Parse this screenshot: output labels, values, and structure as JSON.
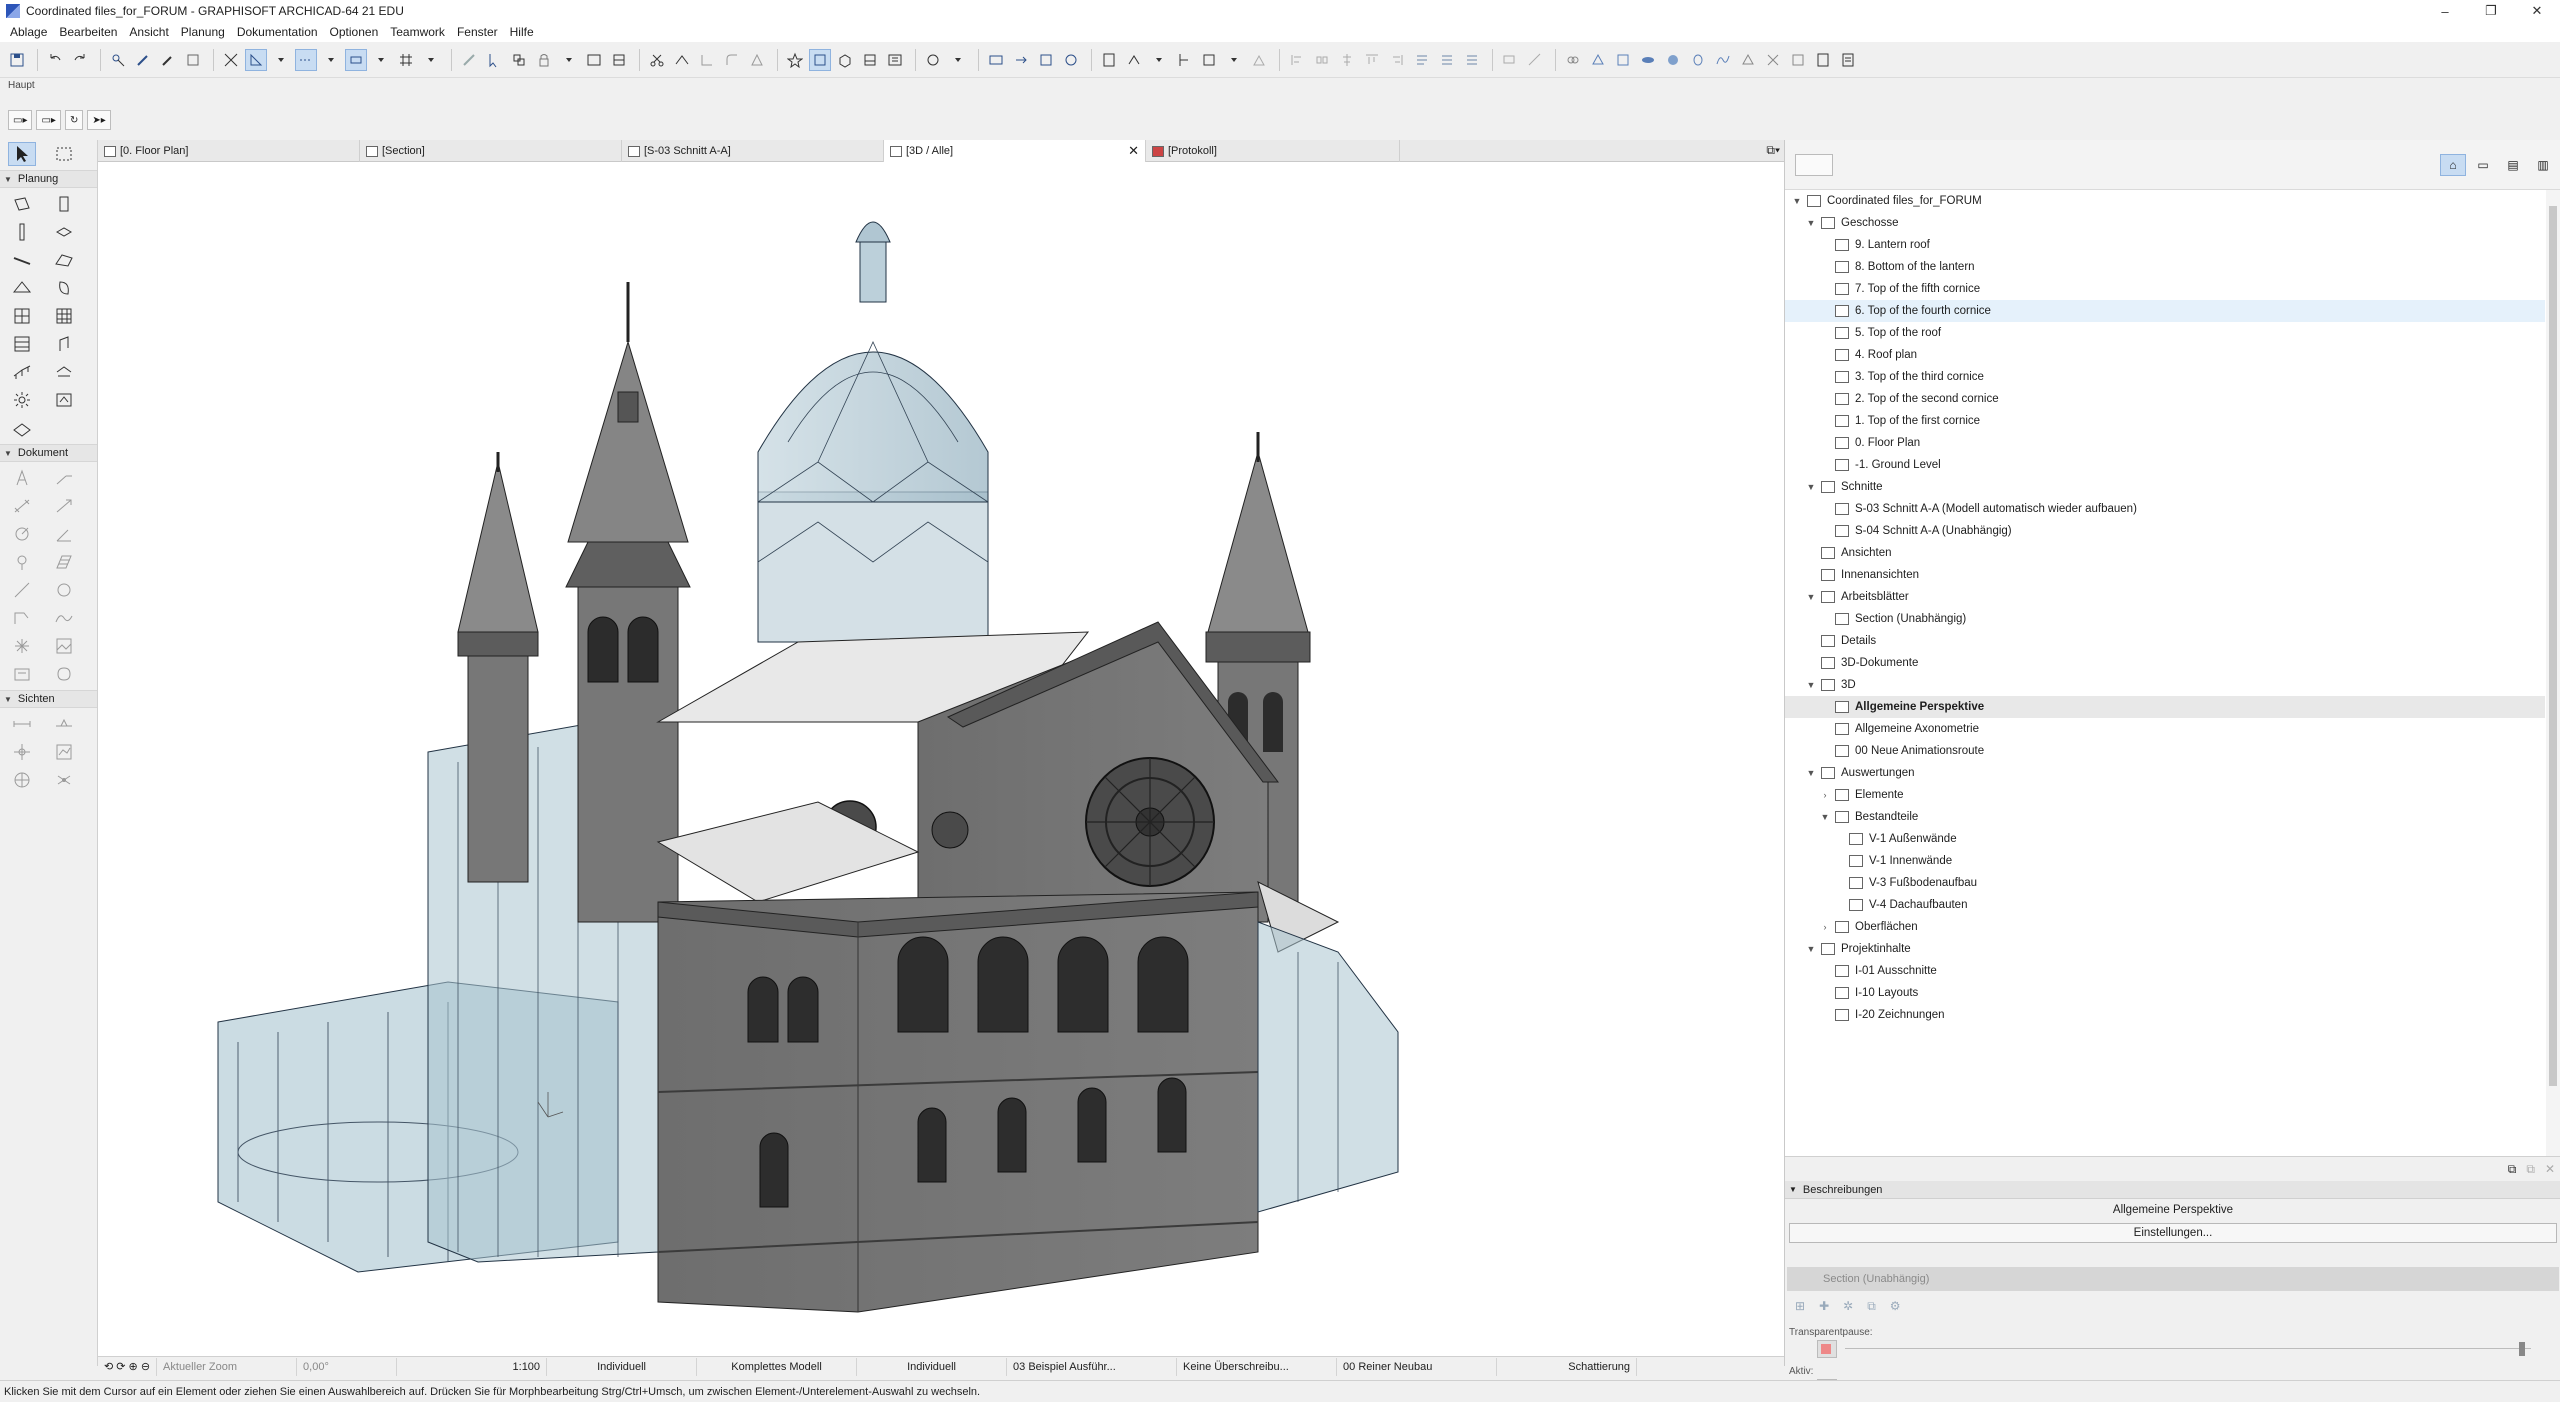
{
  "window": {
    "title": "Coordinated files_for_FORUM - GRAPHISOFT ARCHICAD-64 21 EDU",
    "minimize": "–",
    "restore": "❐",
    "close": "✕"
  },
  "menu": [
    "Ablage",
    "Bearbeiten",
    "Ansicht",
    "Planung",
    "Dokumentation",
    "Optionen",
    "Teamwork",
    "Fenster",
    "Hilfe"
  ],
  "toolbar": {
    "label": "Haupt"
  },
  "toolbox": {
    "sections": [
      {
        "label": "Planung",
        "collapse": "▼"
      },
      {
        "label": "Dokument",
        "collapse": "▼"
      },
      {
        "label": "Sichten",
        "collapse": "▼"
      }
    ]
  },
  "tabs": [
    {
      "label": "[0. Floor Plan]"
    },
    {
      "label": "[Section]"
    },
    {
      "label": "[S-03 Schnitt A-A]"
    },
    {
      "label": "[3D / Alle]",
      "close": "✕"
    },
    {
      "label": "[Protokoll]"
    }
  ],
  "navigator": {
    "tree": [
      {
        "label": "Coordinated files_for_FORUM",
        "level": 0,
        "twisty": "▼"
      },
      {
        "label": "Geschosse",
        "level": 1,
        "twisty": "▼"
      },
      {
        "label": "9. Lantern roof",
        "level": 2,
        "twisty": ""
      },
      {
        "label": "8. Bottom of the lantern",
        "level": 2,
        "twisty": ""
      },
      {
        "label": "7. Top of the fifth cornice",
        "level": 2,
        "twisty": ""
      },
      {
        "label": "6. Top of the fourth cornice",
        "level": 2,
        "twisty": "",
        "state": "hl"
      },
      {
        "label": "5. Top of the roof",
        "level": 2,
        "twisty": ""
      },
      {
        "label": "4. Roof plan",
        "level": 2,
        "twisty": ""
      },
      {
        "label": "3. Top of the third cornice",
        "level": 2,
        "twisty": ""
      },
      {
        "label": "2. Top of the second cornice",
        "level": 2,
        "twisty": ""
      },
      {
        "label": "1. Top of the first cornice",
        "level": 2,
        "twisty": ""
      },
      {
        "label": "0. Floor Plan",
        "level": 2,
        "twisty": ""
      },
      {
        "label": "-1. Ground Level",
        "level": 2,
        "twisty": ""
      },
      {
        "label": "Schnitte",
        "level": 1,
        "twisty": "▼"
      },
      {
        "label": "S-03 Schnitt A-A (Modell automatisch wieder aufbauen)",
        "level": 2,
        "twisty": ""
      },
      {
        "label": "S-04 Schnitt A-A (Unabhängig)",
        "level": 2,
        "twisty": ""
      },
      {
        "label": "Ansichten",
        "level": 1,
        "twisty": ""
      },
      {
        "label": "Innenansichten",
        "level": 1,
        "twisty": ""
      },
      {
        "label": "Arbeitsblätter",
        "level": 1,
        "twisty": "▼"
      },
      {
        "label": "Section (Unabhängig)",
        "level": 2,
        "twisty": ""
      },
      {
        "label": "Details",
        "level": 1,
        "twisty": ""
      },
      {
        "label": "3D-Dokumente",
        "level": 1,
        "twisty": ""
      },
      {
        "label": "3D",
        "level": 1,
        "twisty": "▼"
      },
      {
        "label": "Allgemeine Perspektive",
        "level": 2,
        "twisty": "",
        "state": "sel"
      },
      {
        "label": "Allgemeine Axonometrie",
        "level": 2,
        "twisty": ""
      },
      {
        "label": "00 Neue Animationsroute",
        "level": 2,
        "twisty": ""
      },
      {
        "label": "Auswertungen",
        "level": 1,
        "twisty": "▼"
      },
      {
        "label": "Elemente",
        "level": 2,
        "twisty": "›"
      },
      {
        "label": "Bestandteile",
        "level": 2,
        "twisty": "▼"
      },
      {
        "label": "V-1 Außenwände",
        "level": 3,
        "twisty": ""
      },
      {
        "label": "V-1 Innenwände",
        "level": 3,
        "twisty": ""
      },
      {
        "label": "V-3 Fußbodenaufbau",
        "level": 3,
        "twisty": ""
      },
      {
        "label": "V-4 Dachaufbauten",
        "level": 3,
        "twisty": ""
      },
      {
        "label": "Oberflächen",
        "level": 2,
        "twisty": "›"
      },
      {
        "label": "Projektinhalte",
        "level": 1,
        "twisty": "▼"
      },
      {
        "label": "I-01 Ausschnitte",
        "level": 2,
        "twisty": ""
      },
      {
        "label": "I-10 Layouts",
        "level": 2,
        "twisty": ""
      },
      {
        "label": "I-20 Zeichnungen",
        "level": 2,
        "twisty": ""
      }
    ]
  },
  "descriptions": {
    "header": "Beschreibungen",
    "collapse": "▼",
    "view_name": "Allgemeine Perspektive",
    "settings_button": "Einstellungen...",
    "disabled_view": "Section (Unabhängig)",
    "transparency_label": "Transparentpause:",
    "active_label": "Aktiv:"
  },
  "bottombar": {
    "zoom_label": "Aktueller Zoom",
    "angle": "0,00°",
    "scale": "1:100",
    "layer_combo": "Individuell",
    "model_view": "Komplettes Modell",
    "pen_set": "Individuell",
    "renovation": "03 Beispiel Ausführ...",
    "override": "Keine Überschreibu...",
    "renovation_filter": "00 Reiner Neubau",
    "shading": "Schattierung"
  },
  "status_text": "Klicken Sie mit dem Cursor auf ein Element oder ziehen Sie einen Auswahlbereich auf. Drücken Sie für Morphbearbeitung Strg/Ctrl+Umsch, um zwischen Element-/Unterelement-Auswahl zu wechseln.",
  "colors": {
    "glass": "#a9c4d0",
    "stone": "#767676",
    "roof": "#8f8f8f",
    "selection": "#c8dcf2"
  }
}
